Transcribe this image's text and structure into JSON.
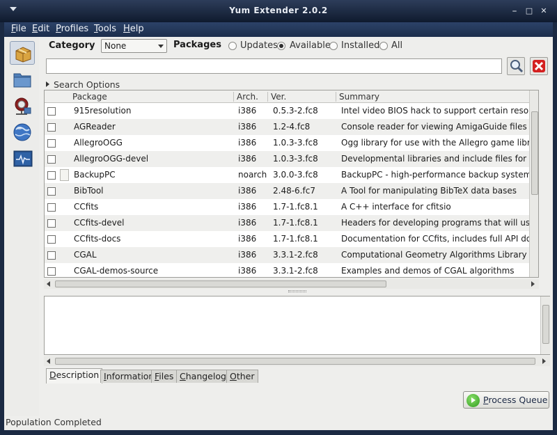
{
  "window": {
    "title": "Yum Extender 2.0.2"
  },
  "menu": [
    {
      "acc": "F",
      "rest": "ile"
    },
    {
      "acc": "E",
      "rest": "dit"
    },
    {
      "acc": "P",
      "rest": "rofiles"
    },
    {
      "acc": "T",
      "rest": "ools"
    },
    {
      "acc": "H",
      "rest": "elp"
    }
  ],
  "sidebar": {
    "icons": [
      "package-box-icon",
      "folder-icon",
      "repository-icon",
      "globe-icon",
      "monitor-output-icon"
    ],
    "active_index": 0
  },
  "filters": {
    "category_label": "Category",
    "category_value": "None",
    "packages_label": "Packages",
    "options": [
      "Updates",
      "Available",
      "Installed",
      "All"
    ],
    "selected": "Available"
  },
  "search": {
    "value": "",
    "options_label": "Search Options"
  },
  "table": {
    "columns": {
      "package": "Package",
      "arch": "Arch.",
      "ver": "Ver.",
      "summary": "Summary"
    },
    "rows": [
      {
        "name": "915resolution",
        "arch": "i386",
        "ver": "0.5.3-2.fc8",
        "summary": "Intel video BIOS hack to support certain resolutio"
      },
      {
        "name": "AGReader",
        "arch": "i386",
        "ver": "1.2-4.fc8",
        "summary": "Console reader for viewing AmigaGuide files"
      },
      {
        "name": "AllegroOGG",
        "arch": "i386",
        "ver": "1.0.3-3.fc8",
        "summary": "Ogg library for use with the Allegro game library"
      },
      {
        "name": "AllegroOGG-devel",
        "arch": "i386",
        "ver": "1.0.3-3.fc8",
        "summary": "Developmental libraries and include files for Alle"
      },
      {
        "name": "BackupPC",
        "arch": "noarch",
        "ver": "3.0.0-3.fc8",
        "summary": "BackupPC - high-performance backup system"
      },
      {
        "name": "BibTool",
        "arch": "i386",
        "ver": "2.48-6.fc7",
        "summary": "A Tool for manipulating BibTeX data bases"
      },
      {
        "name": "CCfits",
        "arch": "i386",
        "ver": "1.7-1.fc8.1",
        "summary": "A C++ interface for cfitsio"
      },
      {
        "name": "CCfits-devel",
        "arch": "i386",
        "ver": "1.7-1.fc8.1",
        "summary": "Headers for developing programs that will use C"
      },
      {
        "name": "CCfits-docs",
        "arch": "i386",
        "ver": "1.7-1.fc8.1",
        "summary": "Documentation for CCfits, includes full API docs"
      },
      {
        "name": "CGAL",
        "arch": "i386",
        "ver": "3.3.1-2.fc8",
        "summary": "Computational Geometry Algorithms Library"
      },
      {
        "name": "CGAL-demos-source",
        "arch": "i386",
        "ver": "3.3.1-2.fc8",
        "summary": "Examples and demos of CGAL algorithms"
      }
    ]
  },
  "description": {
    "text": ""
  },
  "tabs": [
    {
      "acc": "D",
      "rest": "escription",
      "active": true
    },
    {
      "acc": "I",
      "rest": "nformation",
      "active": false
    },
    {
      "acc": "F",
      "rest": "iles",
      "active": false
    },
    {
      "acc": "C",
      "rest": "hangelog",
      "active": false
    },
    {
      "acc": "O",
      "rest": "ther",
      "active": false
    }
  ],
  "process_button": {
    "acc": "P",
    "rest": "rocess Queue"
  },
  "status": {
    "text": "Population Completed"
  }
}
